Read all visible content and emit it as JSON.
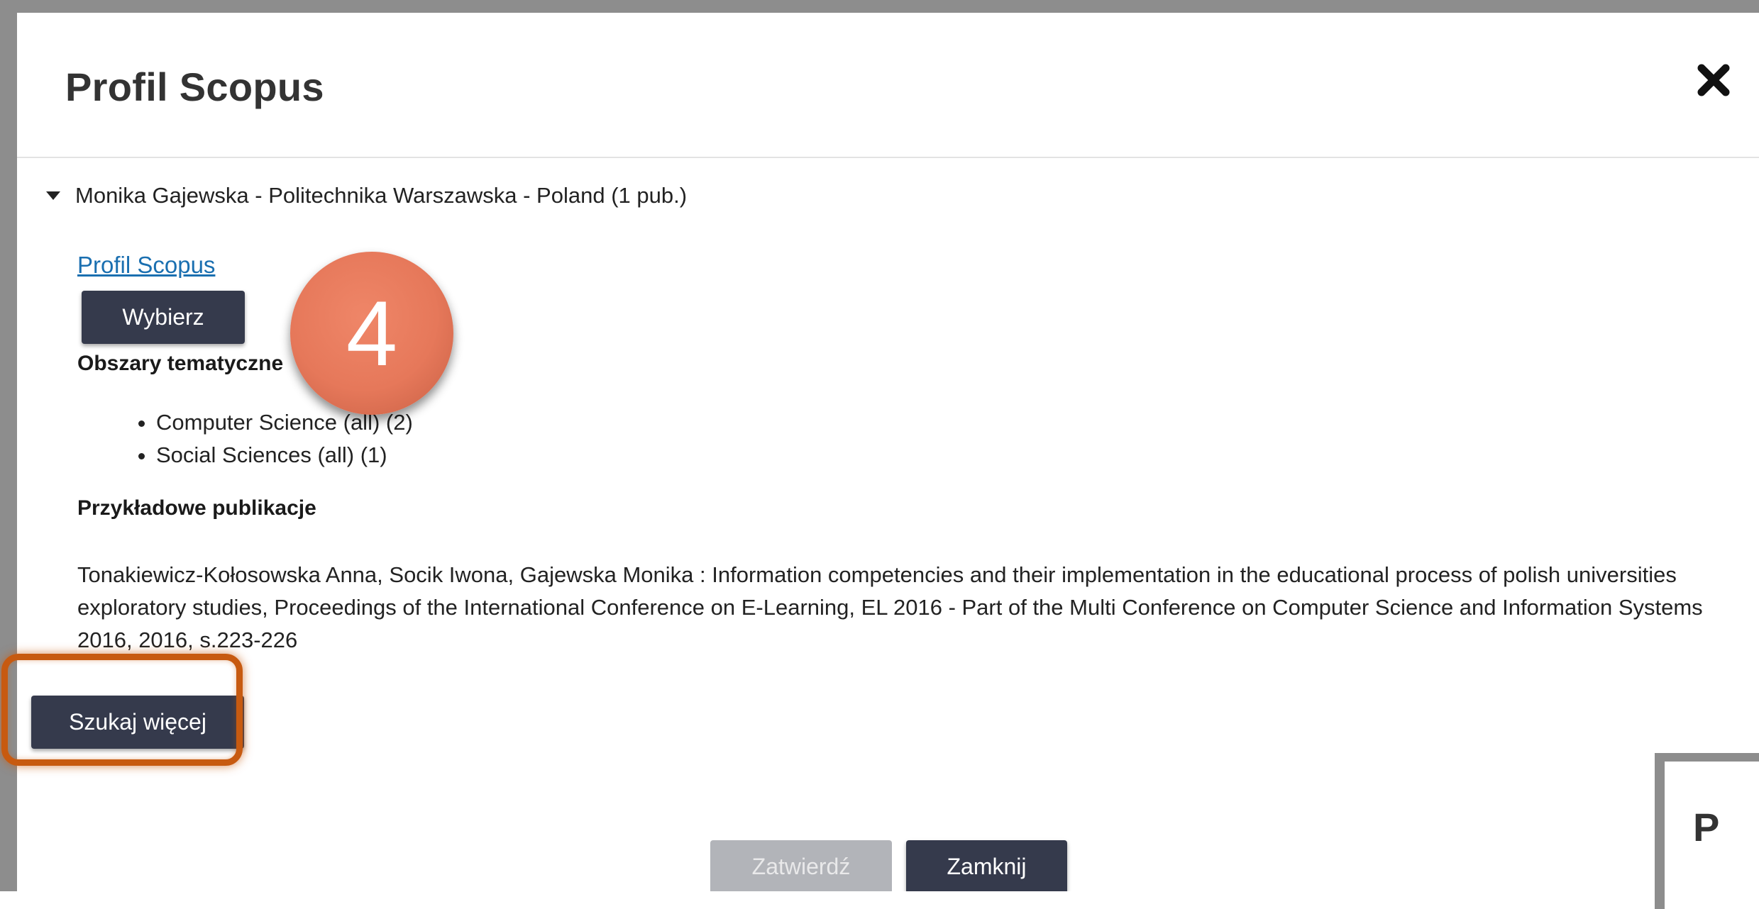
{
  "modal": {
    "title": "Profil Scopus",
    "close_glyph": "✖"
  },
  "result": {
    "header": "Monika Gajewska - Politechnika Warszawska - Poland (1 pub.)",
    "profile_link": "Profil Scopus",
    "select_button": "Wybierz",
    "topics_heading": "Obszary tematyczne",
    "topics": [
      "Computer Science (all) (2)",
      "Social Sciences (all) (1)"
    ],
    "publications_heading": "Przykładowe publikacje",
    "publication": "Tonakiewicz-Kołosowska Anna, Socik Iwona, Gajewska Monika : Information competencies and their implementation in the educational process of polish universities exploratory studies, Proceedings of the International Conference on E-Learning, EL 2016 - Part of the Multi Conference on Computer Science and Information Systems 2016, 2016, s.223-226"
  },
  "search_more_button": "Szukaj więcej",
  "step_badge": "4",
  "footer": {
    "confirm_button": "Zatwierdź",
    "close_button": "Zamknij"
  },
  "second_modal": {
    "title_fragment": "P"
  },
  "colors": {
    "dark_button": "#353a4c",
    "link": "#1a6fb0",
    "highlight": "#c75a10",
    "badge": "#e6785a",
    "disabled_button": "#b2b4b9"
  },
  "icons": {
    "close": "close-icon",
    "caret": "caret-down-icon"
  }
}
